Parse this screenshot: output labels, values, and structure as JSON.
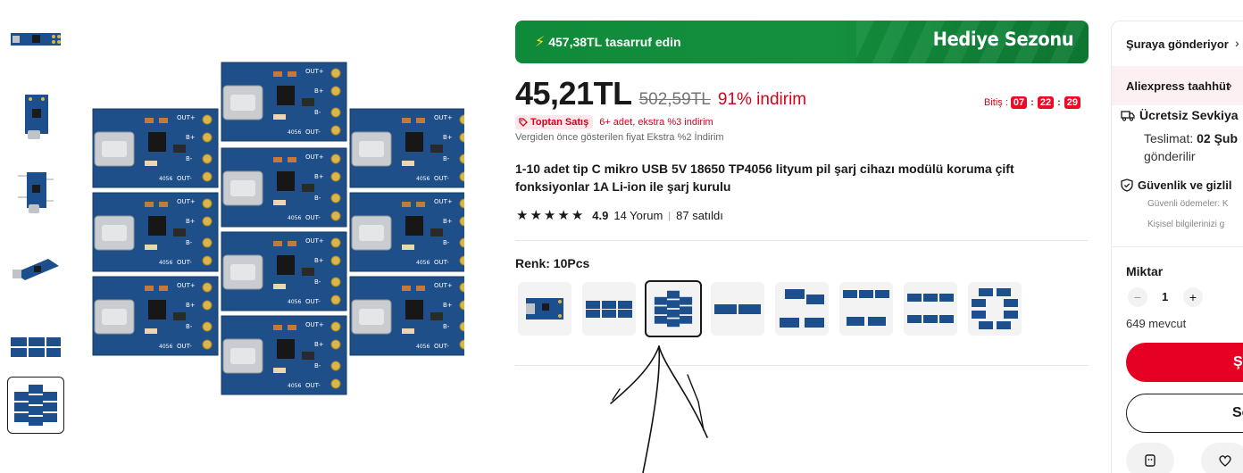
{
  "gallery": {
    "thumbnails": [
      {
        "icon": "board-strip-thumb"
      },
      {
        "icon": "single-board-thumb"
      },
      {
        "icon": "board-diagram-thumb"
      },
      {
        "icon": "board-angle-thumb"
      },
      {
        "icon": "boards-row-thumb"
      },
      {
        "icon": "ten-boards-thumb",
        "selected": true
      }
    ],
    "main_image": "ten-tp4056-boards"
  },
  "promo": {
    "savings": "457,38TL tasarruf edin",
    "event": "Hediye Sezonu",
    "color_primary": "#0f8a3a"
  },
  "pricing": {
    "current": "45,21TL",
    "original": "502,59TL",
    "discount": "91% indirim",
    "countdown_label": "Bitiş :",
    "countdown": [
      "07",
      "22",
      "29"
    ],
    "wholesale_badge": "Toptan Satış",
    "wholesale_text": "6+ adet, ekstra %3 indirim",
    "tax_note": "Vergiden önce gösterilen fiyat Ekstra %2 İndirim",
    "accent_color": "#d3031c"
  },
  "product": {
    "title": "1-10 adet tip C mikro USB 5V 18650 TP4056 lityum pil şarj cihazı modülü koruma çift fonksiyonlar 1A Li-ion ile şarj kurulu",
    "rating": "4.9",
    "stars": 5,
    "reviews": "14 Yorum",
    "divider": "|",
    "sold": "87 satıldı"
  },
  "variants": {
    "label": "Renk: 10Pcs",
    "options": [
      {
        "count": 1
      },
      {
        "count": 3
      },
      {
        "count": 10,
        "selected": true
      },
      {
        "count": 2
      },
      {
        "count": 4
      },
      {
        "count": 5
      },
      {
        "count": 6
      },
      {
        "count": 8
      }
    ]
  },
  "side_panel": {
    "ship_to": "Şuraya gönderiyor",
    "commitment": "Aliexpress taahhüt",
    "free_shipping": "Ücretsiz Sevkiya",
    "delivery_prefix": "Teslimat: ",
    "delivery_date": "02 Şub",
    "delivery_suffix": "gönderilir",
    "security": "Güvenlik ve gizlil",
    "security_line1": "Güvenli ödemeler: K",
    "security_line2": "Kişisel bilgilerinizi g",
    "quantity_label": "Miktar",
    "quantity_minus": "−",
    "quantity": "1",
    "quantity_plus": "+",
    "stock": "649 mevcut",
    "buy_label": "Ş",
    "cart_label": "Se"
  }
}
